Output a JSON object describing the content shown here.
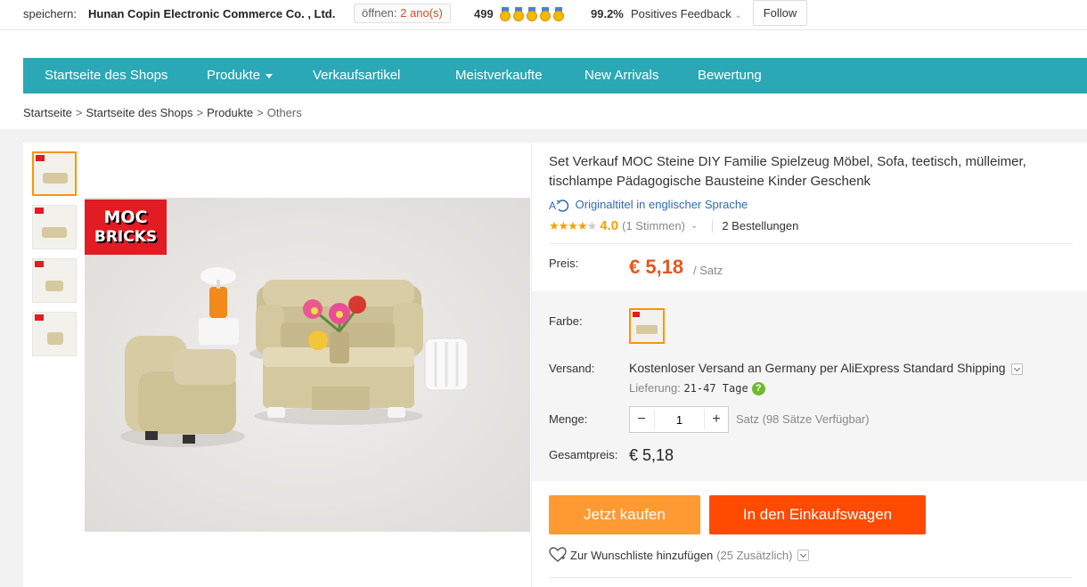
{
  "topbar": {
    "save_label": "speichern:",
    "store_name": "Hunan Copin Electronic Commerce Co. , Ltd.",
    "open_label": "öffnen:",
    "open_years": "2 ano(s)",
    "score": "499",
    "feedback_percent": "99.2%",
    "feedback_label": "Positives Feedback",
    "follow_label": "Follow"
  },
  "nav": {
    "items": [
      {
        "label": "Startseite des Shops"
      },
      {
        "label": "Produkte"
      },
      {
        "label": "Verkaufsartikel"
      },
      {
        "label": "Meistverkaufte"
      },
      {
        "label": "New Arrivals"
      },
      {
        "label": "Bewertung"
      }
    ]
  },
  "breadcrumb": {
    "items": [
      "Startseite",
      "Startseite des Shops",
      "Produkte",
      "Others"
    ],
    "separator": ">"
  },
  "product": {
    "image_logo_line1": "MOC",
    "image_logo_line2": "BRICKS",
    "title": "Set Verkauf MOC Steine DIY Familie Spielzeug Möbel, Sofa, teetisch, mülleimer, tischlampe Pädagogische Bausteine Kinder Geschenk",
    "translate_link": "Originaltitel in englischer Sprache",
    "rating_score": "4.0",
    "rating_votes": "(1 Stimmen)",
    "orders": "2 Bestellungen",
    "price_label": "Preis:",
    "price": "€ 5,18",
    "price_unit": "/ Satz",
    "color_label": "Farbe:",
    "shipping_label": "Versand:",
    "shipping_free": "Kostenloser Versand an",
    "shipping_rest": " Germany per AliExpress Standard Shipping",
    "delivery_label": "Lieferung:",
    "delivery_days": "21-47 Tage",
    "quantity_label": "Menge:",
    "quantity_value": "1",
    "quantity_minus": "−",
    "quantity_plus": "+",
    "availability": "Satz (98 Sätze Verfügbar)",
    "total_label": "Gesamtpreis:",
    "total": "€ 5,18",
    "buy_now": "Jetzt kaufen",
    "add_to_cart": "In den Einkaufswagen",
    "wishlist": "Zur Wunschliste hinzufügen",
    "wishlist_count": "(25 Zusätzlich)"
  },
  "colors": {
    "nav_bg": "#2aa8b6",
    "price": "#e8561c",
    "buy_button": "#ff9a32",
    "cart_button": "#ff4b00",
    "active_border": "#ff9400",
    "link": "#2d6cb6"
  }
}
